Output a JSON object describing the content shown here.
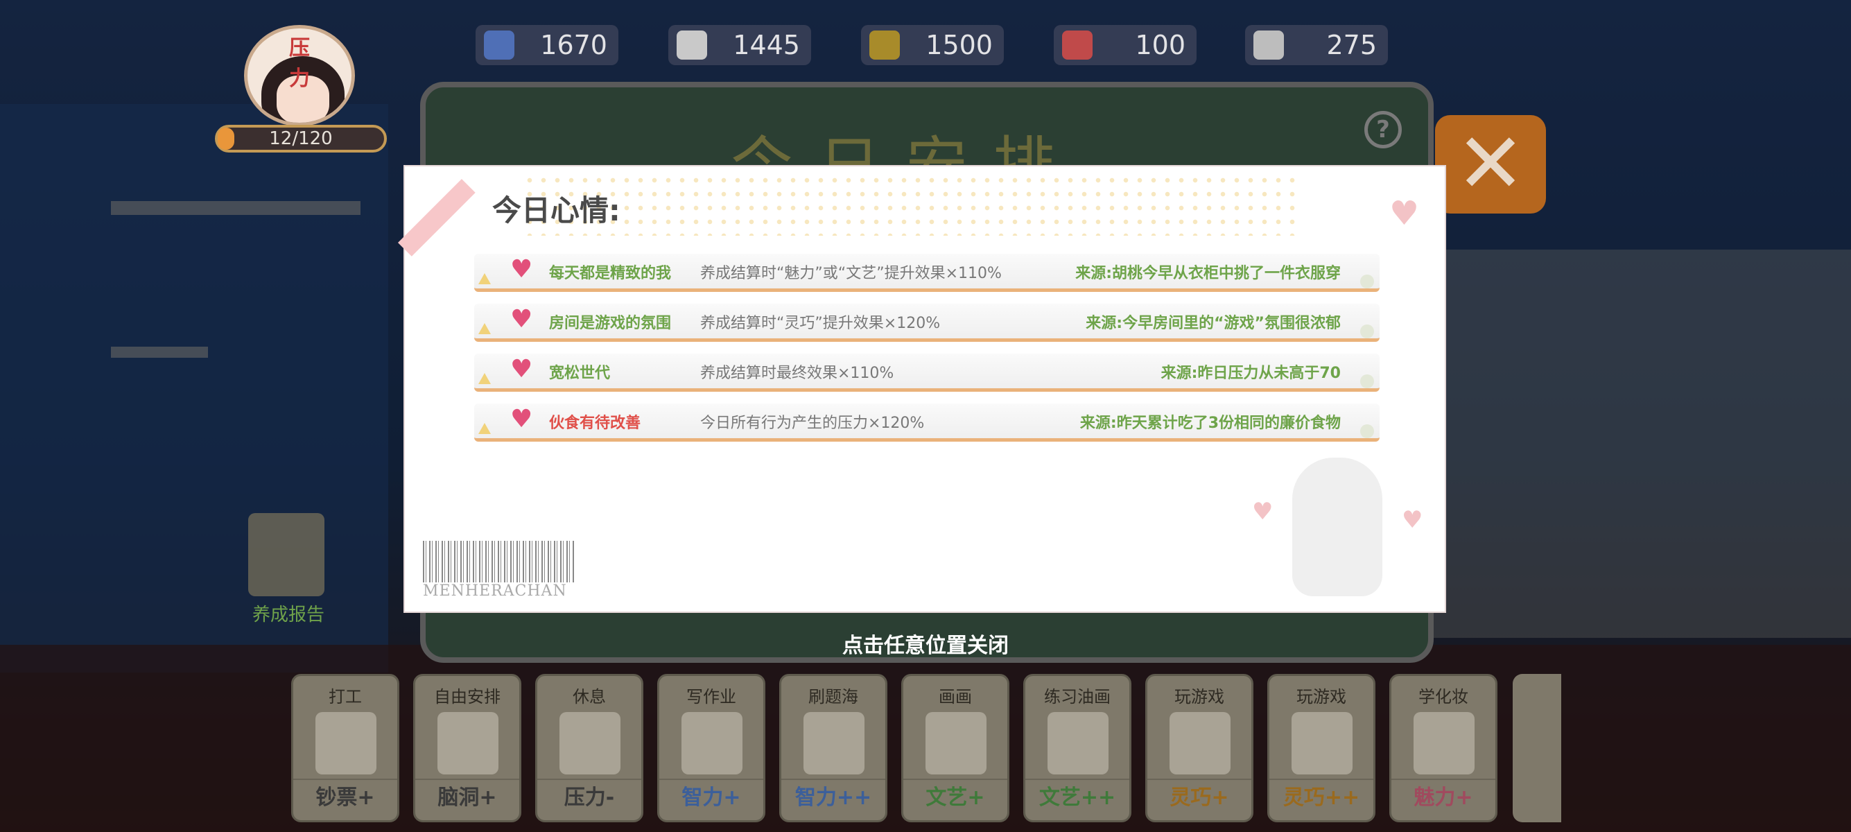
{
  "hud": {
    "avatar_tag": "压力",
    "stress": {
      "current": 12,
      "max": 120,
      "text": "12/120"
    },
    "stats": [
      {
        "icon": "graduation-cap-icon",
        "value": "1670",
        "color": "#4f6fb6"
      },
      {
        "icon": "feather-icon",
        "value": "1445",
        "color": "#c9c9c9"
      },
      {
        "icon": "flashlight-icon",
        "value": "1500",
        "color": "#a88b2a"
      },
      {
        "icon": "flower-icon",
        "value": "100",
        "color": "#c04a4a"
      },
      {
        "icon": "magnifier-icon",
        "value": "275",
        "color": "#bdbdbd"
      }
    ]
  },
  "board": {
    "title": "今日安排",
    "help_label": "?",
    "close_label": "✕"
  },
  "mood_card": {
    "heading": "今日心情:",
    "rows": [
      {
        "name": "每天都是精致的我",
        "name_color": "#6ea44a",
        "effect": "养成结算时“魅力”或“文艺”提升效果×110%",
        "source": "来源:胡桃今早从衣柜中挑了一件衣服穿"
      },
      {
        "name": "房间是游戏的氛围",
        "name_color": "#6ea44a",
        "effect": "养成结算时“灵巧”提升效果×120%",
        "source": "来源:今早房间里的“游戏”氛围很浓郁"
      },
      {
        "name": "宽松世代",
        "name_color": "#6ea44a",
        "effect": "养成结算时最终效果×110%",
        "source": "来源:昨日压力从未高于70"
      },
      {
        "name": "伙食有待改善",
        "name_color": "#e0504a",
        "effect": "今日所有行为产生的压力×120%",
        "source": "来源:昨天累计吃了3份相同的廉价食物"
      }
    ],
    "barcode_text": "MENHERACHAN"
  },
  "close_hint": "点击任意位置关闭",
  "report_label": "养成报告",
  "actions": [
    {
      "top": "打工",
      "bottom": "钞票+",
      "bottom_color": "#3a3a3a"
    },
    {
      "top": "自由安排",
      "bottom": "脑洞+",
      "bottom_color": "#3a3a3a"
    },
    {
      "top": "休息",
      "bottom": "压力-",
      "bottom_color": "#3a3a3a"
    },
    {
      "top": "写作业",
      "bottom": "智力+",
      "bottom_color": "#3c5f9a"
    },
    {
      "top": "刷题海",
      "bottom": "智力++",
      "bottom_color": "#3c5f9a"
    },
    {
      "top": "画画",
      "bottom": "文艺+",
      "bottom_color": "#3f7a3a"
    },
    {
      "top": "练习油画",
      "bottom": "文艺++",
      "bottom_color": "#3f7a3a"
    },
    {
      "top": "玩游戏",
      "bottom": "灵巧+",
      "bottom_color": "#9a6a1e"
    },
    {
      "top": "玩游戏",
      "bottom": "灵巧++",
      "bottom_color": "#9a6a1e"
    },
    {
      "top": "学化妆",
      "bottom": "魅力+",
      "bottom_color": "#a04a5e"
    }
  ]
}
